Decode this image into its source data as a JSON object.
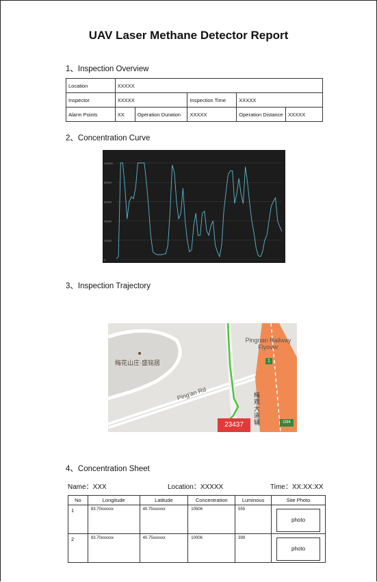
{
  "title": "UAV Laser Methane Detector Report",
  "sections": {
    "overview": "1、Inspection Overview",
    "curve": "2、Concentration Curve",
    "trajectory": "3、Inspection Trajectory",
    "sheet": "4、Concentration Sheet"
  },
  "overview": {
    "location_label": "Location",
    "location_value": "XXXXX",
    "inspector_label": "Inspector",
    "inspector_value": "XXXXX",
    "inspection_time_label": "Inspection Time",
    "inspection_time_value": "XXXXX",
    "alarm_label": "Alarm Points",
    "alarm_value": "XX",
    "duration_label": "Operation Duration",
    "duration_value": "XXXXX",
    "distance_label": "Operation Distance",
    "distance_value": "XXXXX"
  },
  "chart_data": {
    "type": "line",
    "title": "",
    "xlabel": "",
    "ylabel": "",
    "ylim": [
      0,
      105000
    ],
    "yticks": [
      "100000",
      "80000",
      "60000",
      "40000",
      "20000",
      "0"
    ],
    "ytick_values": [
      100000,
      80000,
      60000,
      40000,
      20000,
      0
    ],
    "grid": true,
    "line_color": "#5fb8cf",
    "x": [
      0,
      1,
      2,
      3,
      4,
      5,
      6,
      7,
      8,
      9,
      10,
      11,
      12,
      13,
      14,
      15,
      16,
      17,
      18,
      19,
      20,
      21,
      22,
      23,
      24,
      25,
      26,
      27,
      28,
      29,
      30,
      31,
      32,
      33,
      34,
      35,
      36,
      37,
      38,
      39,
      40,
      41,
      42,
      43,
      44,
      45,
      46,
      47,
      48,
      49,
      50,
      51,
      52,
      53,
      54,
      55,
      56,
      57,
      58,
      59,
      60,
      61,
      62,
      63,
      64,
      65,
      66,
      67,
      68,
      69,
      70,
      71,
      72,
      73,
      74,
      75,
      76,
      77,
      78,
      79,
      80,
      81,
      82,
      83,
      84,
      85,
      86,
      87,
      88,
      89,
      90,
      91,
      92,
      93,
      94,
      95,
      96,
      97,
      98,
      99,
      100
    ],
    "values": [
      1000,
      3000,
      100000,
      100000,
      75000,
      42000,
      60000,
      65000,
      63000,
      75000,
      100000,
      100000,
      100000,
      100000,
      80000,
      55000,
      25000,
      8000,
      6000,
      5000,
      5000,
      5000,
      5500,
      6000,
      15000,
      50000,
      98000,
      90000,
      60000,
      42000,
      48000,
      74000,
      40000,
      20000,
      8000,
      10000,
      35000,
      48000,
      25000,
      25000,
      48000,
      50000,
      30000,
      25000,
      35000,
      40000,
      15000,
      8000,
      3000,
      15000,
      50000,
      70000,
      88000,
      92000,
      92000,
      58000,
      68000,
      84000,
      68000,
      58000,
      96000,
      80000,
      58000,
      40000,
      28000,
      12000,
      4000,
      3000,
      8000,
      20000,
      25000,
      40000,
      55000,
      60000,
      64000,
      40000,
      34000,
      29000
    ]
  },
  "map": {
    "poi_label": "梅花山庄·盛铭居",
    "road_label": "Ping'an Rd",
    "flyover_label": "Pingnan Railway Flyover",
    "highway_label": "梅观大道辅",
    "shield_label": "1",
    "g94_label": "G94",
    "red_marker": "23437"
  },
  "sheet": {
    "name_label": "Name：",
    "name_value": "XXX",
    "location_label": "Location：",
    "location_value": "XXXXX",
    "time_label": "Time：",
    "time_value": "XX:XX:XX",
    "columns": [
      "No",
      "Longitude",
      "Latitude",
      "Concentration",
      "Luminous",
      "Site Photo"
    ],
    "rows": [
      {
        "no": "1",
        "lon": "83.70xxxxxx",
        "lat": "40.75xxxxxx",
        "conc": "10506",
        "lum": "555",
        "photo": "photo"
      },
      {
        "no": "2",
        "lon": "83.70xxxxxx",
        "lat": "40.75xxxxxx",
        "conc": "10006",
        "lum": "399",
        "photo": "photo"
      }
    ]
  }
}
